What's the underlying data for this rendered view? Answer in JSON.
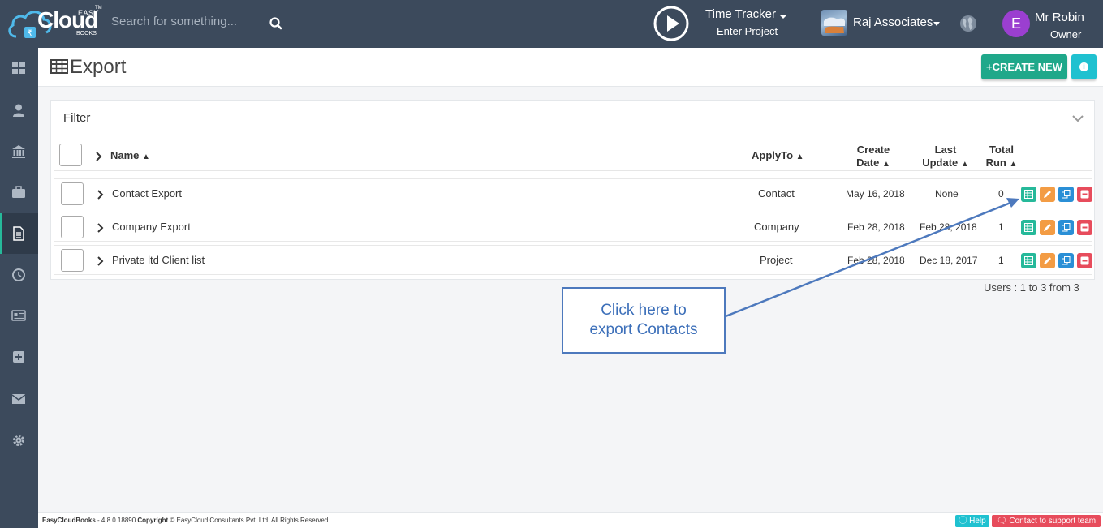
{
  "brand": {
    "easy": "EASY",
    "cloud": "Cloud",
    "books": "BOOKS",
    "tm": "TM"
  },
  "search": {
    "placeholder": "Search for something..."
  },
  "time_tracker": {
    "title": "Time Tracker",
    "subtitle": "Enter Project"
  },
  "company": {
    "name": "Raj Associates"
  },
  "user": {
    "initial": "E",
    "name": "Mr Robin",
    "role": "Owner"
  },
  "sidebar": {
    "items": [
      {
        "icon": "dashboard-icon"
      },
      {
        "icon": "user-icon"
      },
      {
        "icon": "bank-icon"
      },
      {
        "icon": "briefcase-icon"
      },
      {
        "icon": "document-icon",
        "active": true
      },
      {
        "icon": "clock-icon"
      },
      {
        "icon": "newspaper-icon"
      },
      {
        "icon": "plus-square-icon"
      },
      {
        "icon": "mail-icon"
      },
      {
        "icon": "gear-icon"
      }
    ]
  },
  "page": {
    "title": "Export",
    "create_label": "CREATE NEW",
    "create_prefix": "+"
  },
  "filter": {
    "label": "Filter"
  },
  "table": {
    "headers": {
      "name": "Name",
      "apply_to": "ApplyTo",
      "create_date_1": "Create",
      "create_date_2": "Date",
      "last_update_1": "Last",
      "last_update_2": "Update",
      "total_run_1": "Total",
      "total_run_2": "Run"
    },
    "rows": [
      {
        "name": "Contact Export",
        "apply_to": "Contact",
        "create_date": "May 16, 2018",
        "last_update": "None",
        "total_run": "0"
      },
      {
        "name": "Company Export",
        "apply_to": "Company",
        "create_date": "Feb 28, 2018",
        "last_update": "Feb 28, 2018",
        "total_run": "1"
      },
      {
        "name": "Private ltd Client list",
        "apply_to": "Project",
        "create_date": "Feb 28, 2018",
        "last_update": "Dec 18, 2017",
        "total_run": "1"
      }
    ],
    "footer": "Users : 1 to 3 from 3"
  },
  "callout": {
    "line1": "Click here to",
    "line2": "export Contacts"
  },
  "footer": {
    "app": "EasyCloudBooks",
    "version": " - 4.8.0.18890 ",
    "copyright_label": "Copyright",
    "copyright_text": " © EasyCloud Consultants Pvt. Ltd. All Rights Reserved",
    "help": "Help",
    "support": "Contact to support team"
  },
  "colors": {
    "topbar": "#3c4a5c",
    "accent_green": "#26b99a",
    "create_button": "#1fa88a",
    "info_button": "#1fc1d0",
    "avatar": "#9b3fd0",
    "callout_border": "#4d79bd"
  }
}
